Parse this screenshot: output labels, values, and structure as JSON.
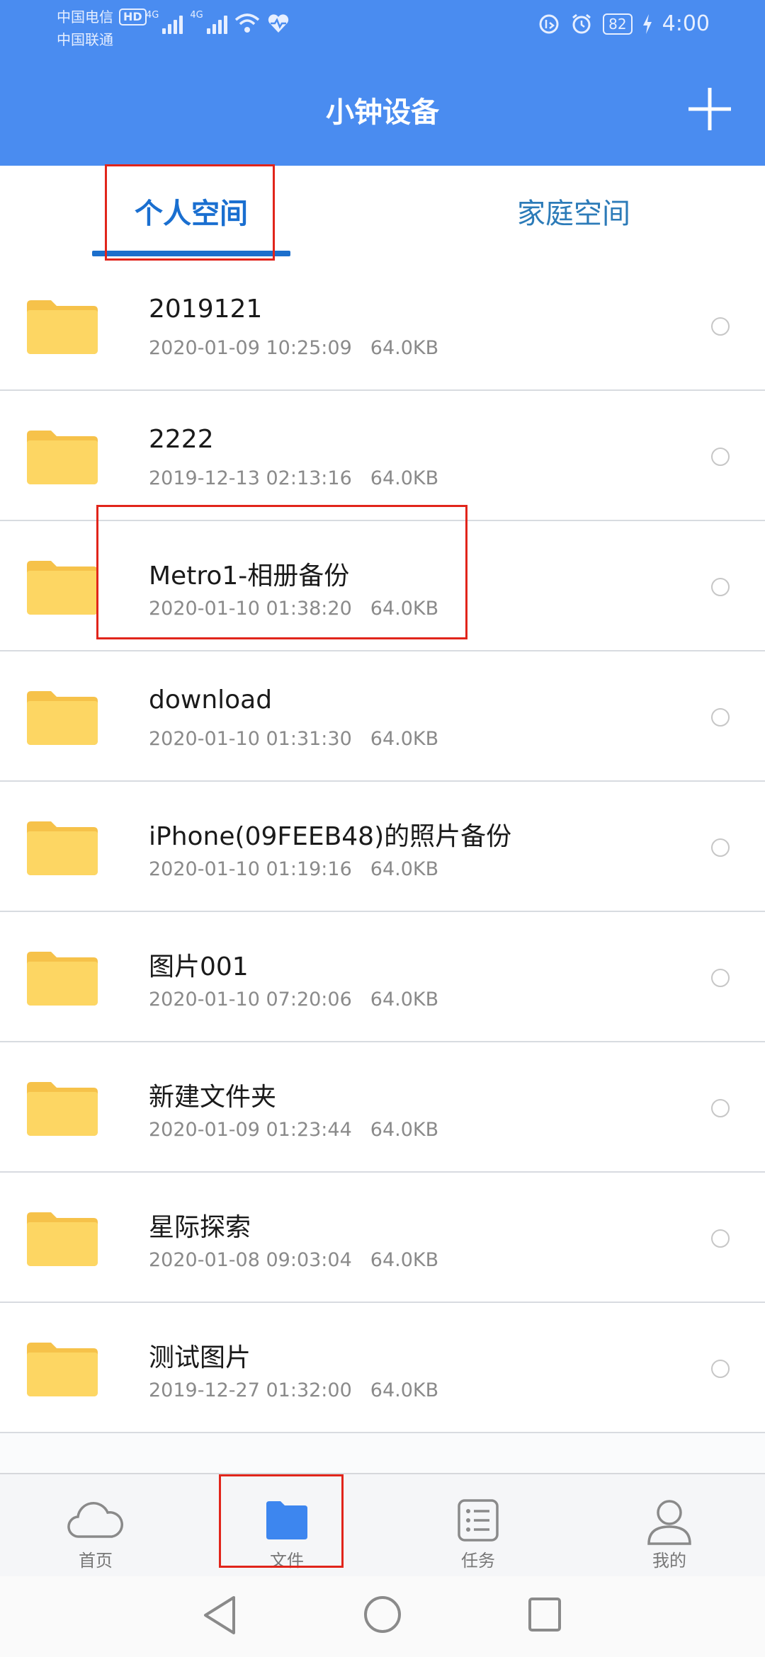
{
  "status": {
    "carrier1": "中国电信",
    "carrier1_badge": "HD",
    "carrier2": "中国联通",
    "signal_label_1": "4G",
    "signal_label_2": "4G",
    "battery": "82",
    "time": "4:00"
  },
  "header": {
    "title": "小钟设备",
    "add_icon": "plus-icon"
  },
  "tabs": [
    {
      "label": "个人空间",
      "active": true
    },
    {
      "label": "家庭空间",
      "active": false
    }
  ],
  "files": [
    {
      "name": "2019121",
      "date": "2020-01-09 10:25:09",
      "size": "64.0KB"
    },
    {
      "name": "2222",
      "date": "2019-12-13 02:13:16",
      "size": "64.0KB"
    },
    {
      "name": "Metro1-相册备份",
      "date": "2020-01-10 01:38:20",
      "size": "64.0KB"
    },
    {
      "name": "download",
      "date": "2020-01-10 01:31:30",
      "size": "64.0KB"
    },
    {
      "name": "iPhone(09FEEB48)的照片备份",
      "date": "2020-01-10 01:19:16",
      "size": "64.0KB"
    },
    {
      "name": "图片001",
      "date": "2020-01-10 07:20:06",
      "size": "64.0KB"
    },
    {
      "name": "新建文件夹",
      "date": "2020-01-09 01:23:44",
      "size": "64.0KB"
    },
    {
      "name": "星际探索",
      "date": "2020-01-08 09:03:04",
      "size": "64.0KB"
    },
    {
      "name": "测试图片",
      "date": "2019-12-27 01:32:00",
      "size": "64.0KB"
    }
  ],
  "bottom_nav": [
    {
      "label": "首页",
      "icon": "cloud-icon"
    },
    {
      "label": "文件",
      "icon": "folder-icon",
      "active": true
    },
    {
      "label": "任务",
      "icon": "task-list-icon"
    },
    {
      "label": "我的",
      "icon": "user-icon"
    }
  ],
  "colors": {
    "header": "#4a8cf0",
    "tab_active": "#1a6fd0",
    "folder": "#fdd663",
    "annotation": "#e1251b"
  }
}
